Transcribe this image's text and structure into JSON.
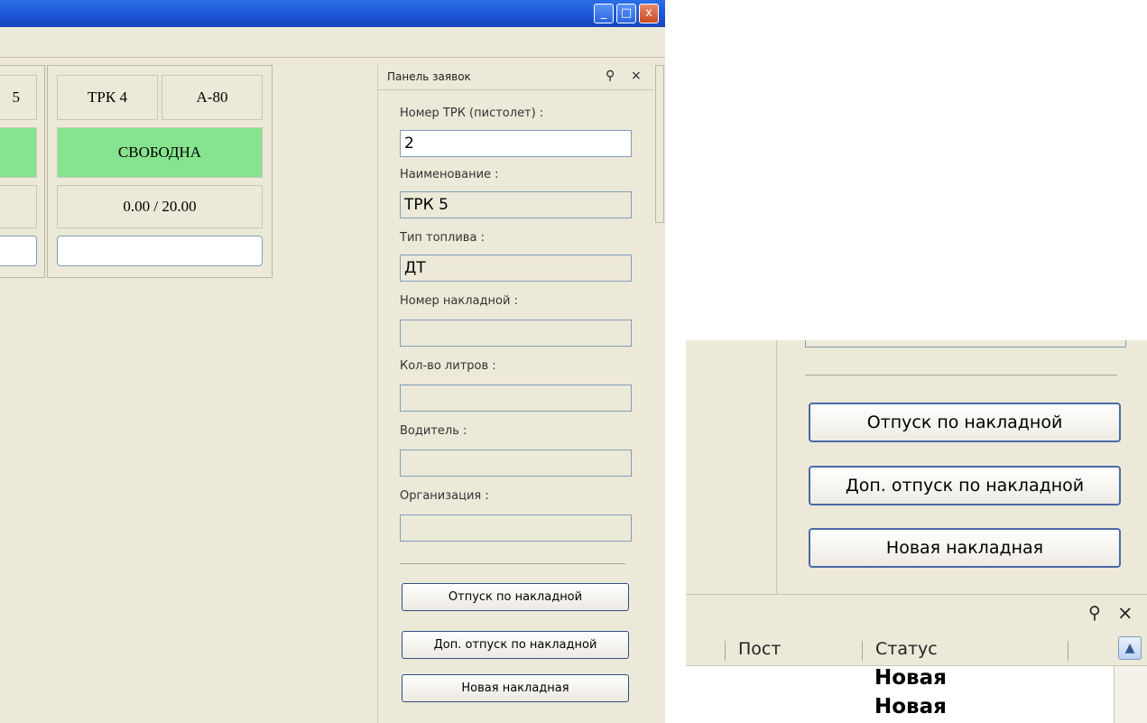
{
  "window": {
    "minimize_glyph": "_",
    "maximize_glyph": "□",
    "close_glyph": "x"
  },
  "pumps": [
    {
      "partial_name": "5"
    },
    {
      "name": "ТРК 4",
      "fuel": "А-80",
      "status": "СВОБОДНА",
      "volume": "0.00 / 20.00"
    }
  ],
  "panel": {
    "title": "Панель заявок",
    "pin_glyph": "⚲",
    "close_glyph": "×",
    "fields": {
      "pump_number": {
        "label": "Номер ТРК (пистолет) :",
        "value": "2"
      },
      "name": {
        "label": "Наименование :",
        "value": "ТРК 5"
      },
      "fuel_type": {
        "label": "Тип топлива :",
        "value": "ДТ"
      },
      "invoice_number": {
        "label": "Номер накладной :",
        "value": ""
      },
      "liters": {
        "label": "Кол-во литров :",
        "value": ""
      },
      "driver": {
        "label": "Водитель :",
        "value": ""
      },
      "organization": {
        "label": "Организация :",
        "value": ""
      }
    },
    "buttons": {
      "dispense_by_invoice": "Отпуск по накладной",
      "extra_dispense_by_invoice": "Доп. отпуск по накладной",
      "new_invoice": "Новая накладная"
    }
  },
  "zoom": {
    "buttons": {
      "dispense_by_invoice": "Отпуск по накладной",
      "extra_dispense_by_invoice": "Доп. отпуск по накладной",
      "new_invoice": "Новая накладная"
    },
    "list": {
      "pin_glyph": "⚲",
      "close_glyph": "×",
      "columns": [
        "Пост",
        "Статус"
      ],
      "rows": [
        {
          "status": "Новая"
        },
        {
          "status": "Новая"
        }
      ],
      "scroll_up_glyph": "▲"
    }
  }
}
